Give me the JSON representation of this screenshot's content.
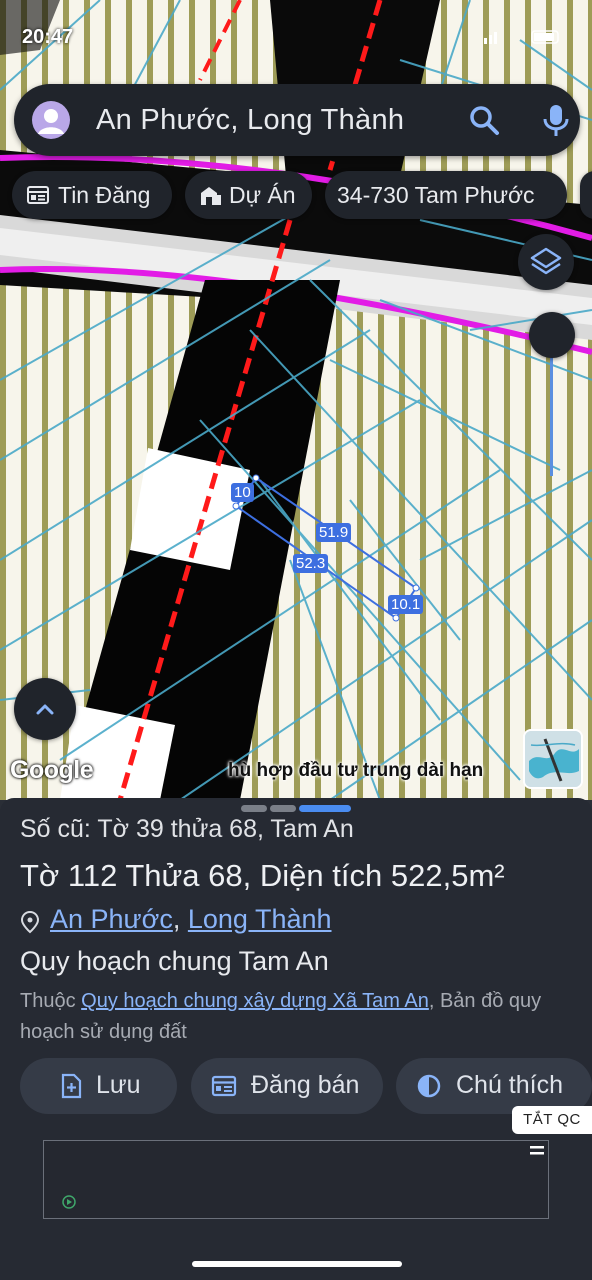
{
  "status_bar": {
    "time": "20:47"
  },
  "search": {
    "query": "An Phước, Long Thành"
  },
  "chips": [
    {
      "label": "Tin Đăng",
      "icon": "listing-icon"
    },
    {
      "label": "Dự Án",
      "icon": "building-icon"
    },
    {
      "label": "34-730 Tam Phước",
      "icon": ""
    }
  ],
  "map": {
    "measurements": [
      "10",
      "51.9",
      "52.3",
      "10.1"
    ],
    "attribution": "Google",
    "overlay_text": "hù hợp đầu tư trung dài hạn",
    "colors": {
      "road_dark": "#000000",
      "road_red": "#ff1a1a",
      "boundary_magenta": "#e21ce6",
      "parcel_lines": "#4aa9c8",
      "zoning_stripe": "#9c9a55",
      "measure_blue": "#3d6fe0"
    }
  },
  "sheet": {
    "old_id": "Số cũ: Tờ 39 thửa 68, Tam An",
    "parcel": {
      "to_label": "Tờ",
      "to_value": "112",
      "thua_label": "Thửa",
      "thua_value": "68",
      "area_label": "Diện tích",
      "area_value": "522,5m²"
    },
    "location": {
      "ward": "An Phước",
      "separator": ",",
      "district": "Long Thành"
    },
    "plan_title": "Quy hoạch chung Tam An",
    "belongs": {
      "prefix": "Thuộc",
      "link": "Quy hoạch chung xây dựng Xã Tam An",
      "suffix": ", Bản đồ quy hoạch sử dụng đất"
    },
    "actions": [
      {
        "label": "Lưu",
        "icon": "add-file-icon"
      },
      {
        "label": "Đăng bán",
        "icon": "listing-icon"
      },
      {
        "label": "Chú thích",
        "icon": "contrast-icon"
      }
    ],
    "ad_tag": "TẮT QC"
  }
}
